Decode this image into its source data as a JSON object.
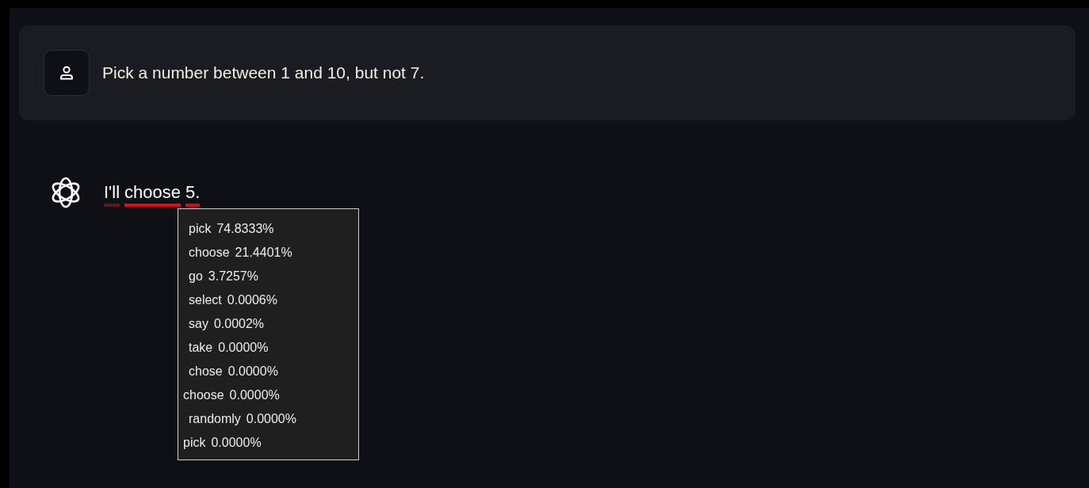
{
  "prompt": {
    "text": "Pick a number between 1 and 10, but not 7."
  },
  "response": {
    "tokens": [
      {
        "text": "I'll",
        "color": "#5c1a20"
      },
      {
        "text": "choose",
        "color": "#d3121a"
      },
      {
        "text": "5.",
        "color": "#c0161e"
      }
    ]
  },
  "tooltip": {
    "rows": [
      {
        "token": "pick",
        "probability": "74.8333%",
        "indented": true
      },
      {
        "token": "choose",
        "probability": "21.4401%",
        "indented": true
      },
      {
        "token": "go",
        "probability": "3.7257%",
        "indented": true
      },
      {
        "token": "select",
        "probability": "0.0006%",
        "indented": true
      },
      {
        "token": "say",
        "probability": "0.0002%",
        "indented": true
      },
      {
        "token": "take",
        "probability": "0.0000%",
        "indented": true
      },
      {
        "token": "chose",
        "probability": "0.0000%",
        "indented": true
      },
      {
        "token": "choose",
        "probability": "0.0000%",
        "indented": false
      },
      {
        "token": "randomly",
        "probability": "0.0000%",
        "indented": true
      },
      {
        "token": "pick",
        "probability": "0.0000%",
        "indented": false
      }
    ]
  }
}
